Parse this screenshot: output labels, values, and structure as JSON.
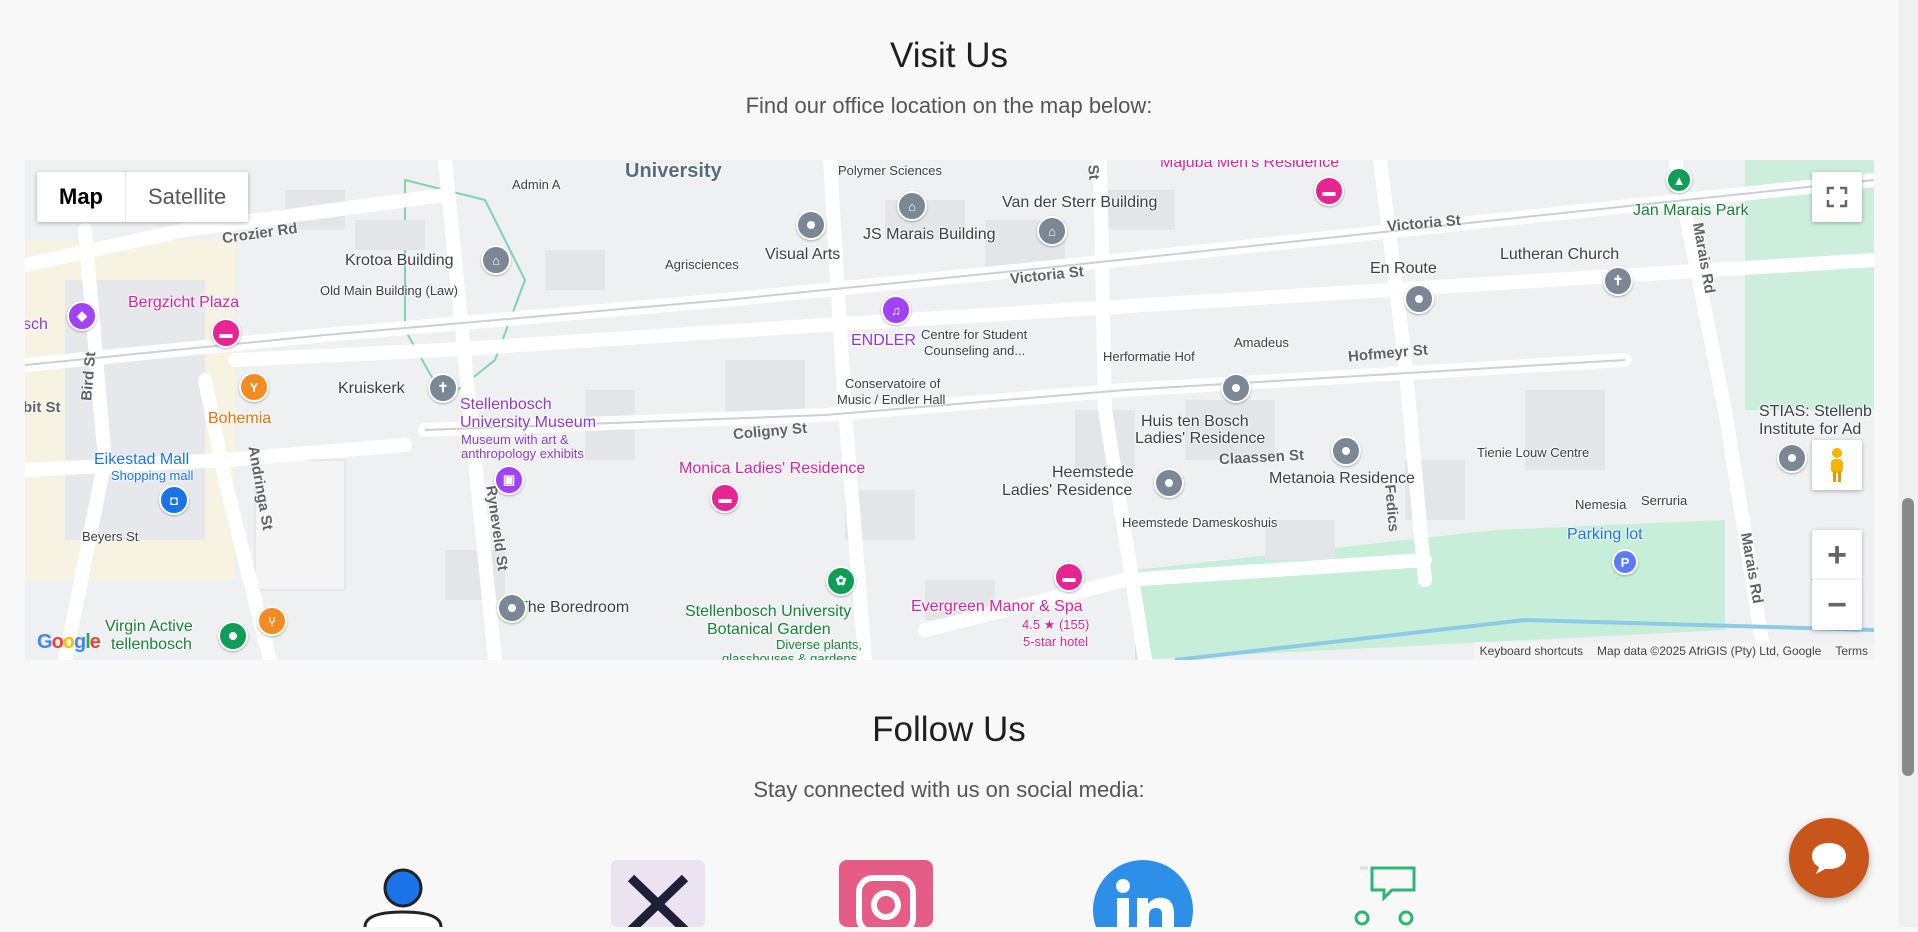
{
  "visit": {
    "title": "Visit Us",
    "subtitle": "Find our office location on the map below:"
  },
  "map": {
    "type_map": "Map",
    "type_satellite": "Satellite",
    "attribution": {
      "shortcuts": "Keyboard shortcuts",
      "data": "Map data ©2025 AfriGIS (Pty) Ltd, Google",
      "terms": "Terms"
    },
    "logo": "Google",
    "labels": {
      "university": "University",
      "polymer": "Polymer Sciences",
      "majuba": "Majuba Men's Residence",
      "admin_a": "Admin A",
      "van_der_sterr": "Van der Sterr Building",
      "js_marais": "JS Marais Building",
      "visual_arts": "Visual Arts",
      "crozier": "Crozier Rd",
      "victoria1": "Victoria St",
      "victoria2": "Victoria St",
      "jan_marais": "Jan Marais Park",
      "lutheran": "Lutheran Church",
      "en_route": "En Route",
      "krotoa": "Krotoa Building",
      "agrisciences": "Agrisciences",
      "old_main": "Old Main Building (Law)",
      "bergzicht": "Bergzicht Plaza",
      "sch": "sch",
      "endler": "ENDLER",
      "csc1": "Centre for Student",
      "csc2": "Counseling and...",
      "herformatie": "Herformatie Hof",
      "amadeus": "Amadeus",
      "hofmeyr": "Hofmeyr St",
      "marais_rd1": "Marais Rd",
      "marais_rd2": "Marais Rd",
      "bird": "Bird St",
      "bohemia": "Bohemia",
      "kruiskerk": "Kruiskerk",
      "stell_museum1": "Stellenbosch",
      "stell_museum2": "University Museum",
      "museum_desc1": "Museum with art &",
      "museum_desc2": "anthropology exhibits",
      "conservatoire1": "Conservatoire of",
      "conservatoire2": "Music / Endler Hall",
      "huis_ten_bosch1": "Huis ten Bosch",
      "huis_ten_bosch2": "Ladies' Residence",
      "stias1": "STIAS: Stellenb",
      "stias2": "Institute for Ad",
      "pit": "bit St",
      "eikestad": "Eikestad Mall",
      "shopping": "Shopping mall",
      "andringa": "Andringa St",
      "coligny": "Coligny St",
      "monica": "Monica Ladies' Residence",
      "heemstede1": "Heemstede",
      "heemstede2": "Ladies' Residence",
      "claassen": "Claassen St",
      "metanoia": "Metanoia Residence",
      "tienie": "Tienie Louw Centre",
      "nemesia": "Nemesia",
      "serruria": "Serruria",
      "fedics": "Fedics",
      "heemstede_dk": "Heemstede Dameskoshuis",
      "parking": "Parking lot",
      "beyers": "Beyers St",
      "ryneveld": "Ryneveld St",
      "boredroom": "The Boredroom",
      "botanical1": "Stellenbosch University",
      "botanical2": "Botanical Garden",
      "botanical3": "Diverse plants,",
      "botanical4": "glasshouses & gardens",
      "evergreen": "Evergreen Manor & Spa",
      "evergreen_rating": "4.5 ★ (155)",
      "evergreen_type": "5-star hotel",
      "virgin1": "Virgin Active",
      "virgin2": "tellenbosch",
      "st_top": "St"
    }
  },
  "follow": {
    "title": "Follow Us",
    "subtitle": "Stay connected with us on social media:"
  },
  "social": [
    "profile",
    "x",
    "instagram",
    "linkedin",
    "community"
  ]
}
